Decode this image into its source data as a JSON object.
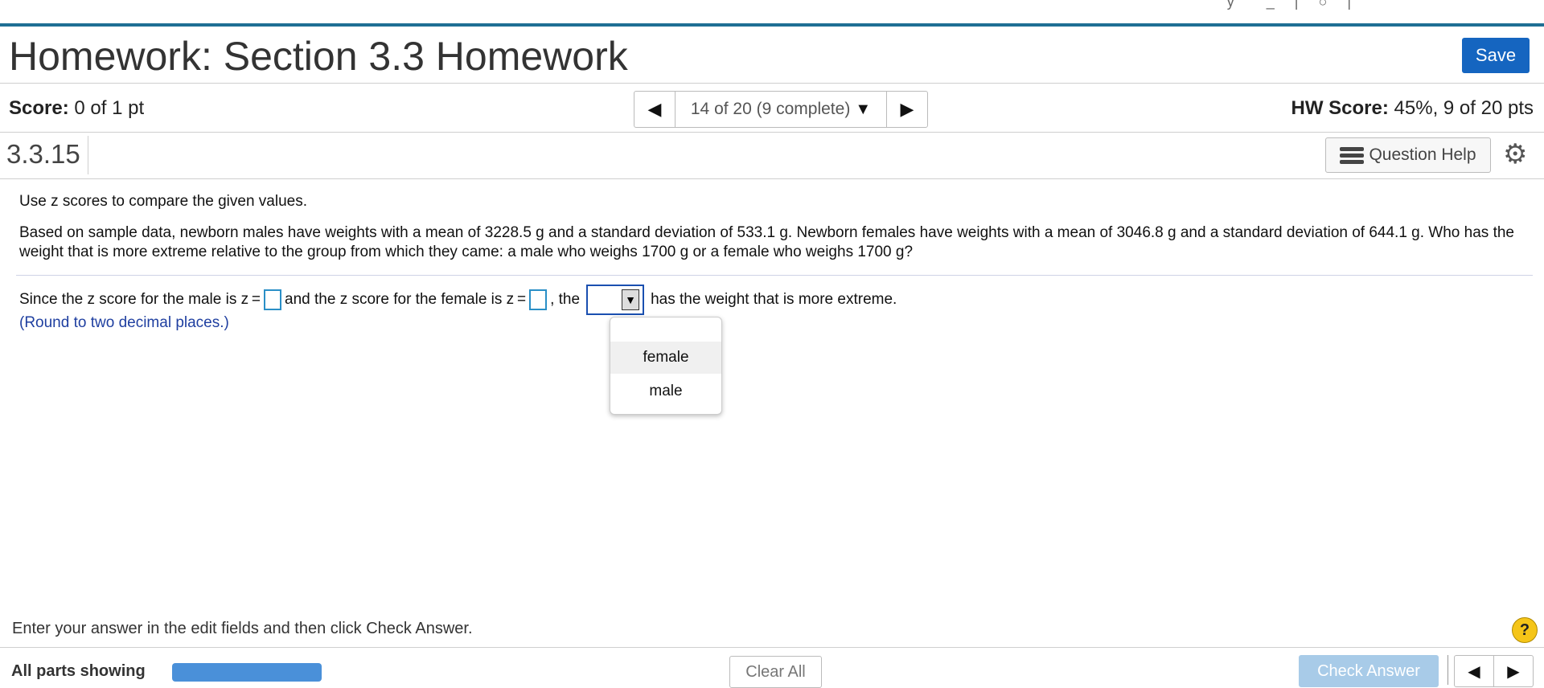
{
  "header": {
    "title": "Homework: Section 3.3 Homework",
    "save_label": "Save"
  },
  "score_bar": {
    "score_label": "Score:",
    "score_value": "0 of 1 pt",
    "nav_position": "14 of 20 (9 complete)",
    "hw_score_label": "HW Score:",
    "hw_score_value": "45%, 9 of 20 pts"
  },
  "question_bar": {
    "number": "3.3.15",
    "help_label": "Question Help"
  },
  "question": {
    "intro": "Use z scores to compare the given values.",
    "problem": "Based on sample data, newborn males have weights with a mean of 3228.5 g and a standard deviation of 533.1 g. Newborn females have weights with a mean of 3046.8 g and a standard deviation of 644.1 g. Who has the weight that is more extreme relative to the group from which they came: a male who weighs 1700 g or a female who weighs 1700 g?",
    "answer_part1": "Since the z score for the male is z =",
    "answer_part2": "and the z score for the female is z =",
    "answer_part3": ", the",
    "answer_part4": "has the weight that is more extreme.",
    "hint": "(Round to two decimal places.)",
    "dropdown_options": [
      "female",
      "male"
    ]
  },
  "footer": {
    "instruction": "Enter your answer in the edit fields and then click Check Answer.",
    "help_symbol": "?",
    "all_parts": "All parts showing",
    "progress_fraction": 1.0,
    "clear_all_label": "Clear All",
    "check_answer_label": "Check Answer"
  },
  "colors": {
    "accent_bar": "#1f6f94",
    "save_button": "#1565c0",
    "progress": "#4a90d9",
    "hint_text": "#1f3fa0",
    "check_answer_disabled": "#a8cbe8"
  }
}
